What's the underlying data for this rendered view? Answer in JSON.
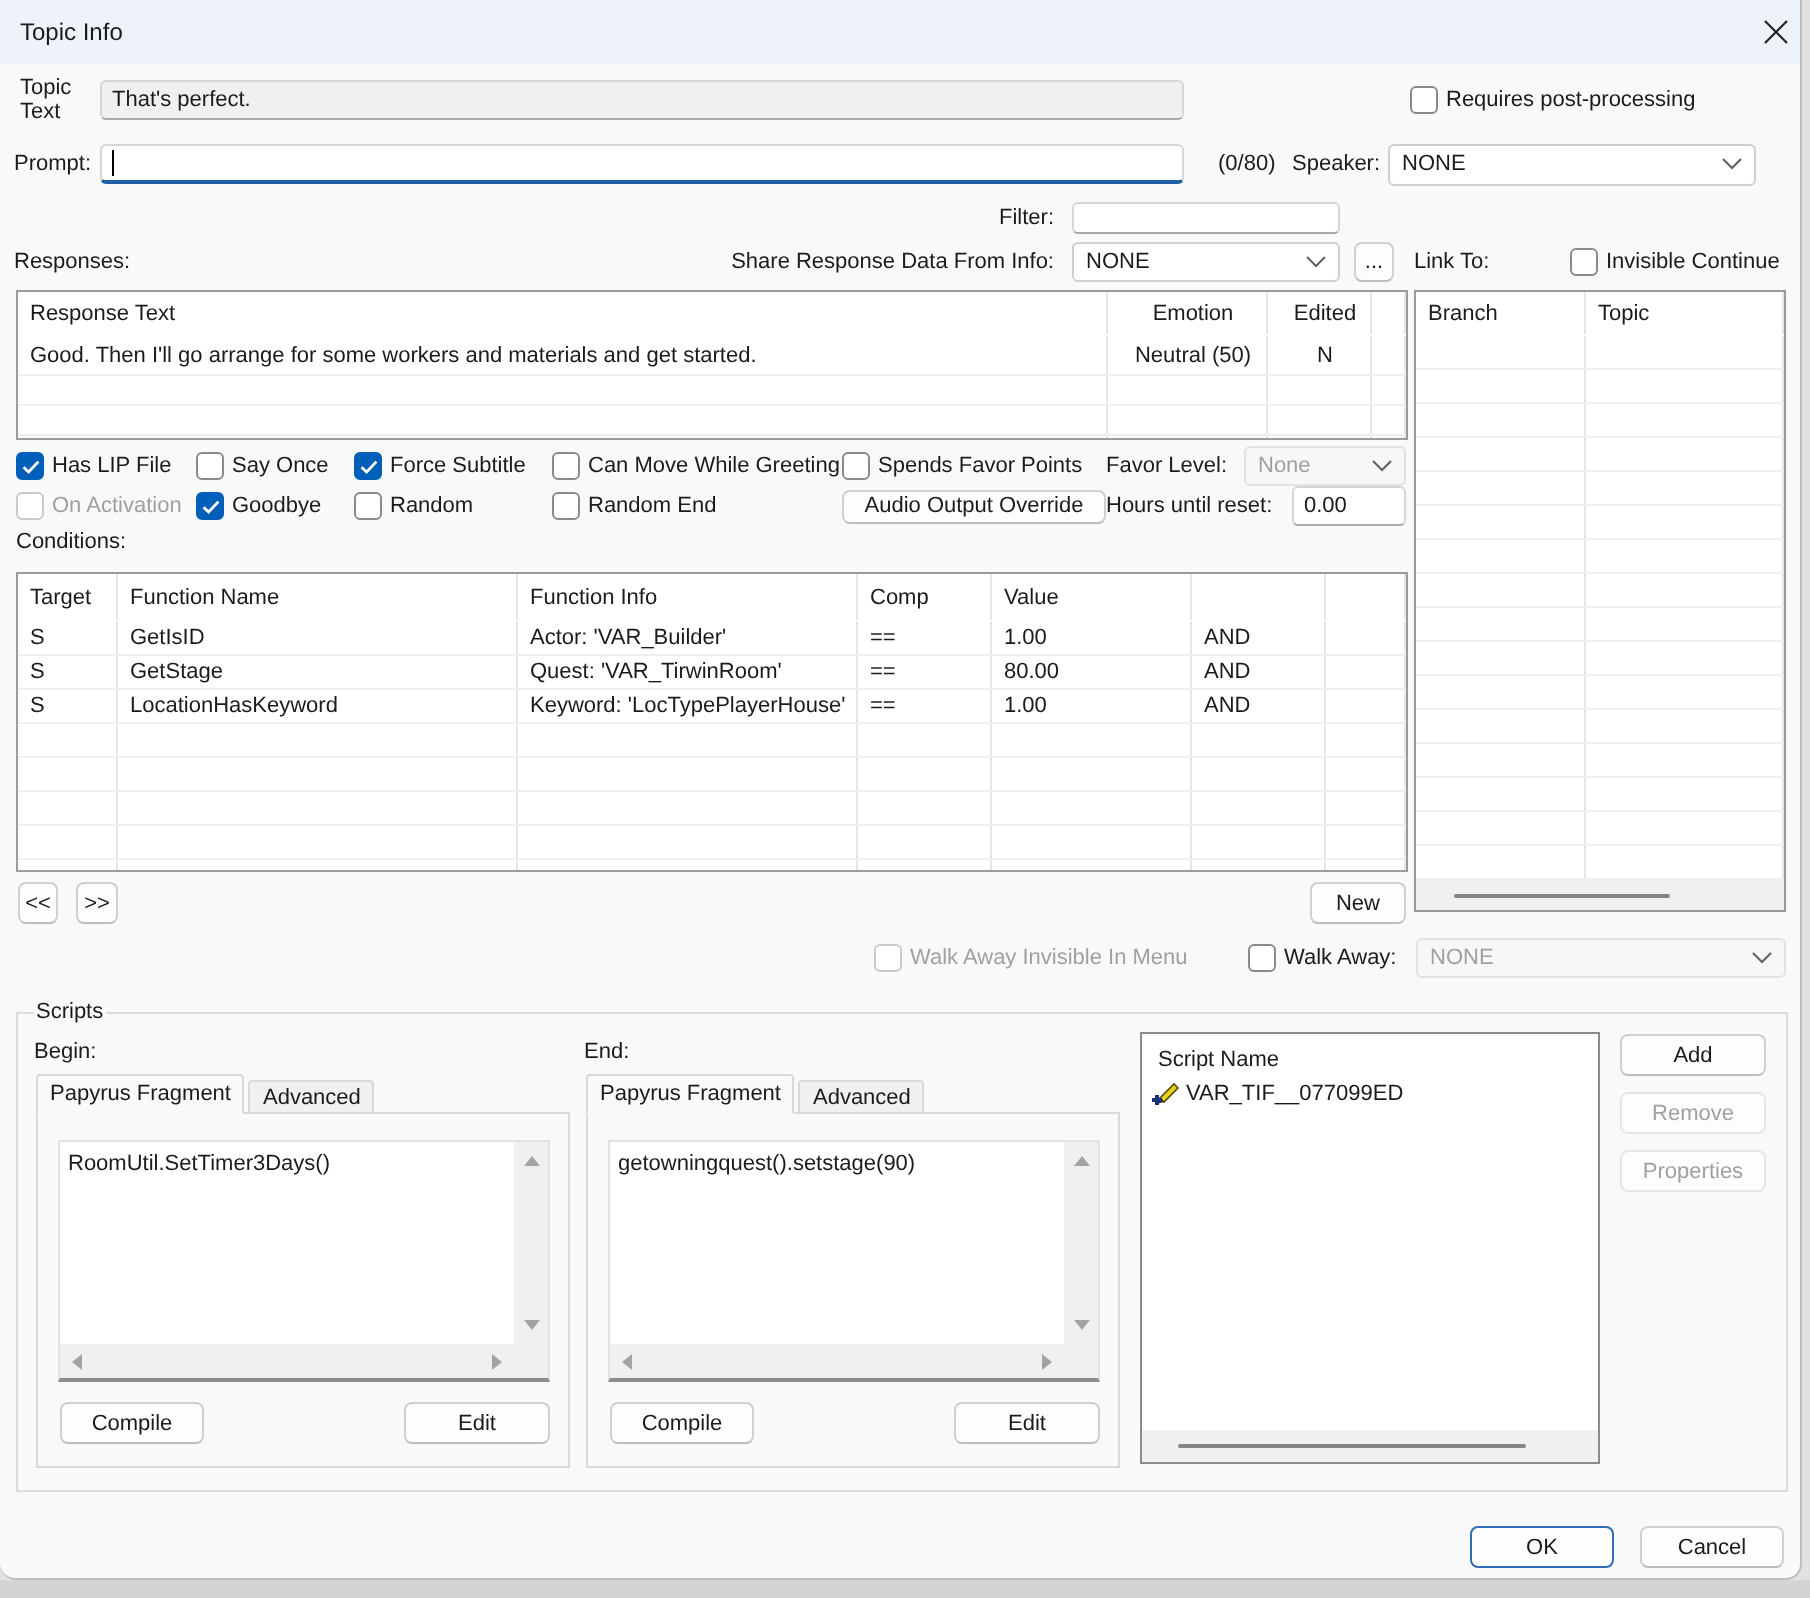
{
  "window": {
    "title": "Topic Info"
  },
  "topic_text": {
    "label": "Topic Text",
    "value": "That's perfect."
  },
  "requires_post_processing": {
    "label": "Requires post-processing",
    "checked": false
  },
  "prompt": {
    "label": "Prompt:",
    "focused": true,
    "counter": "(0/80)"
  },
  "speaker": {
    "label": "Speaker:",
    "value": "NONE"
  },
  "filter": {
    "label": "Filter:"
  },
  "responses": {
    "label": "Responses:",
    "share_label": "Share Response Data From Info:",
    "share_value": "NONE",
    "more_button": "...",
    "columns": [
      "Response Text",
      "Emotion",
      "Edited"
    ],
    "rows": [
      {
        "cells": [
          "Good. Then I'll go arrange for some workers and materials and get started.",
          "Neutral (50)",
          "N"
        ]
      }
    ]
  },
  "link_to": {
    "label": "Link To:",
    "invisible_continue": {
      "label": "Invisible Continue",
      "checked": false
    },
    "columns": [
      "Branch",
      "Topic"
    ]
  },
  "options": [
    [
      {
        "kind": "checkbox",
        "label": "Has LIP File",
        "checked": true,
        "disabled": false
      },
      {
        "kind": "checkbox",
        "label": "Say Once",
        "checked": false,
        "disabled": false
      },
      {
        "kind": "checkbox",
        "label": "Force Subtitle",
        "checked": true,
        "disabled": false
      },
      {
        "kind": "checkbox",
        "label": "Can Move While Greeting",
        "checked": false,
        "disabled": false
      },
      {
        "kind": "checkbox",
        "label": "Spends Favor Points",
        "checked": false,
        "disabled": false
      },
      {
        "kind": "select",
        "label": "Favor Level:",
        "value": "None",
        "disabled": true
      }
    ],
    [
      {
        "kind": "checkbox",
        "label": "On Activation",
        "checked": false,
        "disabled": true
      },
      {
        "kind": "checkbox",
        "label": "Goodbye",
        "checked": true,
        "disabled": false
      },
      {
        "kind": "checkbox",
        "label": "Random",
        "checked": false,
        "disabled": false
      },
      {
        "kind": "checkbox",
        "label": "Random End",
        "checked": false,
        "disabled": false
      },
      {
        "kind": "button",
        "label": "Audio Output Override"
      },
      {
        "kind": "input",
        "label": "Hours until reset:",
        "value": "0.00"
      }
    ]
  ],
  "conditions": {
    "label": "Conditions:",
    "columns": [
      "Target",
      "Function Name",
      "Function Info",
      "Comp",
      "Value"
    ],
    "rows": [
      {
        "cells": [
          "S",
          "GetIsID",
          "Actor: 'VAR_Builder'",
          "==",
          "1.00",
          "AND"
        ]
      },
      {
        "cells": [
          "S",
          "GetStage",
          "Quest: 'VAR_TirwinRoom'",
          "==",
          "80.00",
          "AND"
        ]
      },
      {
        "cells": [
          "S",
          "LocationHasKeyword",
          "Keyword: 'LocTypePlayerHouse'",
          "==",
          "1.00",
          "AND"
        ]
      }
    ],
    "prev_button": "<<",
    "next_button": ">>",
    "new_button": "New"
  },
  "walk_away_invisible": {
    "label": "Walk Away Invisible In Menu",
    "checked": false,
    "disabled": true
  },
  "walk_away": {
    "label": "Walk Away:",
    "checked": false,
    "value": "NONE",
    "disabled": true
  },
  "scripts": {
    "title": "Scripts",
    "fragments": [
      {
        "label": "Begin:",
        "tabs": [
          {
            "label": "Papyrus Fragment",
            "selected": true
          },
          {
            "label": "Advanced",
            "selected": false
          }
        ],
        "code": "RoomUtil.SetTimer3Days()",
        "compile_button": "Compile",
        "edit_button": "Edit"
      },
      {
        "label": "End:",
        "tabs": [
          {
            "label": "Papyrus Fragment",
            "selected": true
          },
          {
            "label": "Advanced",
            "selected": false
          }
        ],
        "code": "getowningquest().setstage(90)",
        "compile_button": "Compile",
        "edit_button": "Edit"
      }
    ],
    "list": {
      "column": "Script Name",
      "items": [
        "VAR_TIF__077099ED"
      ]
    },
    "buttons": [
      {
        "label": "Add",
        "disabled": false
      },
      {
        "label": "Remove",
        "disabled": true
      },
      {
        "label": "Properties",
        "disabled": true
      }
    ]
  },
  "footer": {
    "buttons": [
      {
        "label": "OK",
        "focused": true
      },
      {
        "label": "Cancel",
        "focused": false
      }
    ]
  }
}
